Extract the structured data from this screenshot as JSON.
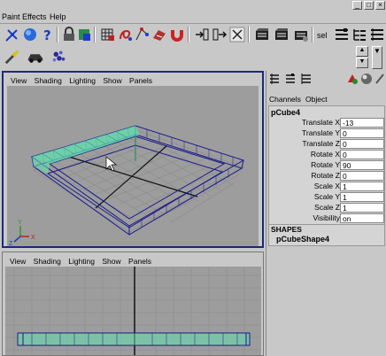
{
  "menubar": {
    "items": [
      "Paint Effects",
      "Help"
    ]
  },
  "window_buttons": [
    "_",
    "□",
    "×"
  ],
  "toolbar": {
    "sel_label": "sel"
  },
  "viewport_top": {
    "menu": [
      "View",
      "Shading",
      "Lighting",
      "Show",
      "Panels"
    ],
    "axis_y": "Y",
    "axis_z": "Z",
    "axis_x": "X"
  },
  "viewport_bottom": {
    "menu": [
      "View",
      "Shading",
      "Lighting",
      "Show",
      "Panels"
    ]
  },
  "channel_box": {
    "tabs": [
      "Channels",
      "Object"
    ],
    "object_name": "pCube4",
    "attributes": [
      {
        "label": "Translate X",
        "value": "-13"
      },
      {
        "label": "Translate Y",
        "value": "0"
      },
      {
        "label": "Translate Z",
        "value": "0"
      },
      {
        "label": "Rotate X",
        "value": "0"
      },
      {
        "label": "Rotate Y",
        "value": "90"
      },
      {
        "label": "Rotate Z",
        "value": "0"
      },
      {
        "label": "Scale X",
        "value": "1"
      },
      {
        "label": "Scale Y",
        "value": "1"
      },
      {
        "label": "Scale Z",
        "value": "1"
      },
      {
        "label": "Visibility",
        "value": "on"
      }
    ],
    "shapes_header": "SHAPES",
    "shape_name": "pCubeShape4"
  },
  "colors": {
    "wire_blue": "#1a1a8c",
    "highlight_teal": "#60e0b0",
    "grid": "#8a8a8a",
    "frame_active": "#1a2a7a"
  }
}
